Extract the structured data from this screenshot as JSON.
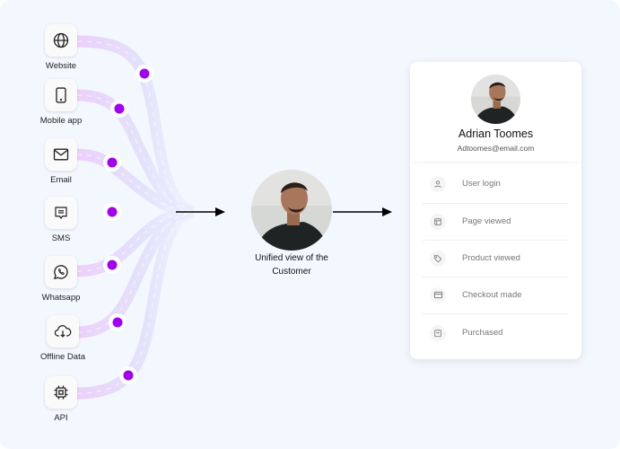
{
  "sources": [
    {
      "label": "Website",
      "icon": "globe-icon"
    },
    {
      "label": "Mobile app",
      "icon": "mobile-icon"
    },
    {
      "label": "Email",
      "icon": "mail-icon"
    },
    {
      "label": "SMS",
      "icon": "message-icon"
    },
    {
      "label": "Whatsapp",
      "icon": "whatsapp-icon"
    },
    {
      "label": "Offline Data",
      "icon": "cloud-download-icon"
    },
    {
      "label": "API",
      "icon": "chip-icon"
    }
  ],
  "center": {
    "label_line1": "Unified view of the",
    "label_line2": "Customer"
  },
  "profile": {
    "name": "Adrian Toomes",
    "email": "Adtoomes@email.com",
    "events": [
      {
        "label": "User login",
        "icon": "user-icon"
      },
      {
        "label": "Page viewed",
        "icon": "layout-icon"
      },
      {
        "label": "Product viewed",
        "icon": "tag-icon"
      },
      {
        "label": "Checkout made",
        "icon": "card-icon"
      },
      {
        "label": "Purchased",
        "icon": "bag-icon"
      }
    ]
  },
  "colors": {
    "dot": "#a400f0",
    "flow_start": "#efd3fb",
    "flow_end": "#dfe6fb",
    "background": "#f3f8ff"
  }
}
